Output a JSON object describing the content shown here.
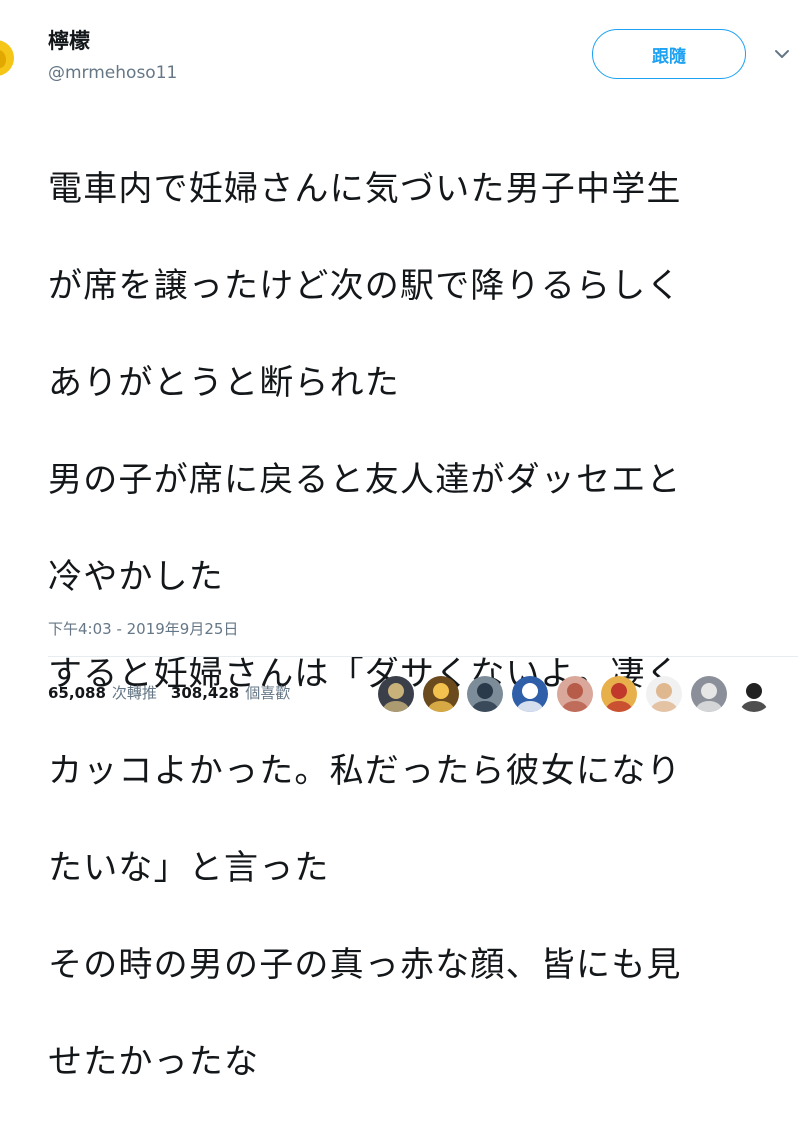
{
  "header": {
    "display_name": "檸檬",
    "handle": "@mrmehoso11",
    "follow_label": "跟隨"
  },
  "tweet": {
    "lines": [
      "電車内で妊婦さんに気づいた男子中学生",
      "が席を譲ったけど次の駅で降りるらしく",
      "ありがとうと断られた",
      "男の子が席に戻ると友人達がダッセエと",
      "冷やかした",
      "すると妊婦さんは「ダサくないよ。凄く",
      "カッコよかった。私だったら彼女になり",
      "たいな」と言った",
      "その時の男の子の真っ赤な顔、皆にも見",
      "せたかったな"
    ],
    "timestamp": "下午4:03 - 2019年9月25日"
  },
  "stats": {
    "retweets_count": "65,088",
    "retweets_label": "次轉推",
    "likes_count": "308,428",
    "likes_label": "個喜歡"
  },
  "likers": [
    {
      "icon": "liker-avatar-1",
      "bg": "#3a3f4a",
      "fg": "#c9b27a"
    },
    {
      "icon": "liker-avatar-2",
      "bg": "#6b4a1e",
      "fg": "#f2c14e"
    },
    {
      "icon": "liker-avatar-3",
      "bg": "#7d8c99",
      "fg": "#2b3a4a"
    },
    {
      "icon": "liker-avatar-4",
      "bg": "#2e5fa8",
      "fg": "#ffffff"
    },
    {
      "icon": "liker-avatar-5",
      "bg": "#d9a89a",
      "fg": "#b85c4a"
    },
    {
      "icon": "liker-avatar-6",
      "bg": "#e8b04a",
      "fg": "#c0392b"
    },
    {
      "icon": "liker-avatar-7",
      "bg": "#f1f1f1",
      "fg": "#e0b890"
    },
    {
      "icon": "liker-avatar-8",
      "bg": "#8a8f99",
      "fg": "#e6e6e6"
    },
    {
      "icon": "liker-avatar-9",
      "bg": "#ffffff",
      "fg": "#222222"
    }
  ],
  "colors": {
    "accent": "#1da1f2",
    "text": "#14171a",
    "muted": "#657786"
  }
}
